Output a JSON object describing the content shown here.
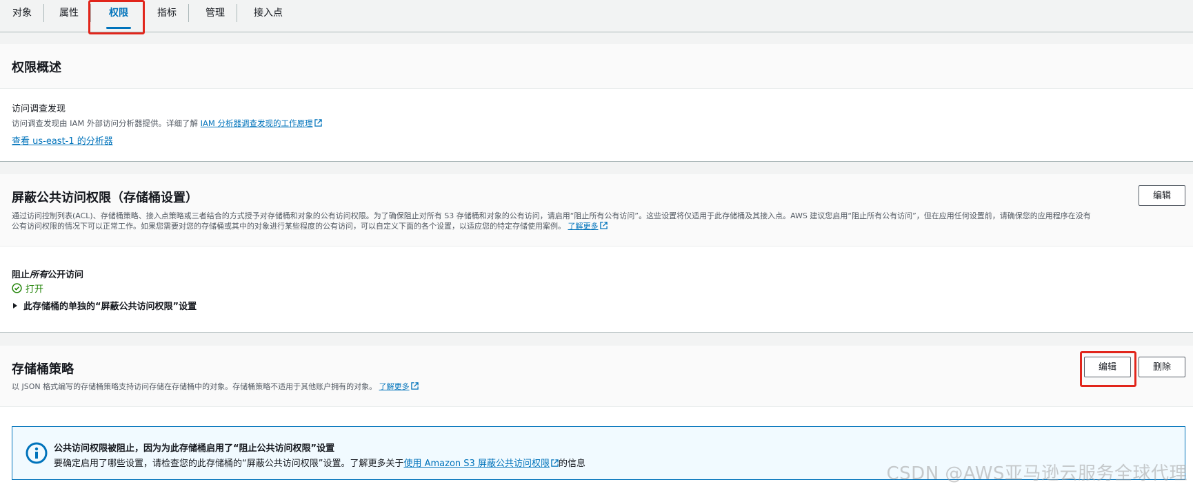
{
  "tabs": [
    {
      "label": "对象"
    },
    {
      "label": "属性"
    },
    {
      "label": "权限"
    },
    {
      "label": "指标"
    },
    {
      "label": "管理"
    },
    {
      "label": "接入点"
    }
  ],
  "overview": {
    "title": "权限概述",
    "findings_label": "访问调查发现",
    "findings_desc": "访问调查发现由 IAM 外部访问分析器提供。详细了解",
    "findings_link": "IAM 分析器调查发现的工作原理",
    "analyzer_link": "查看 us-east-1 的分析器"
  },
  "block_public": {
    "title": "屏蔽公共访问权限（存储桶设置）",
    "edit_label": "编辑",
    "desc_line1": "通过访问控制列表(ACL)、存储桶策略、接入点策略或三者结合的方式授予对存储桶和对象的公有访问权限。为了确保阻止对所有 S3 存储桶和对象的公有访问，请启用“阻止所有公有访问”。这些设置将仅适用于此存储桶及其接入点。AWS 建议您启用“阻止所有公有访问”，但在应用任何设置前，请确保您的应用程序在没有",
    "desc_line2": "公有访问权限的情况下可以正常工作。如果您需要对您的存储桶或其中的对象进行某些程度的公有访问，可以自定义下面的各个设置，以适应您的特定存储使用案例。",
    "learn_more": "了解更多",
    "block_all_prefix": "阻止",
    "block_all_em": "所有",
    "block_all_suffix": "公开访问",
    "status": "打开",
    "expand_label": "此存储桶的单独的“屏蔽公共访问权限”设置"
  },
  "policy": {
    "title": "存储桶策略",
    "desc": "以 JSON 格式编写的存储桶策略支持访问存储在存储桶中的对象。存储桶策略不适用于其他账户拥有的对象。",
    "learn_more": "了解更多",
    "edit_label": "编辑",
    "delete_label": "删除",
    "info_title": "公共访问权限被阻止，因为为此存储桶启用了“阻止公共访问权限”设置",
    "info_text_prefix": "要确定启用了哪些设置，请检查您的此存储桶的“屏蔽公共访问权限”设置。了解更多关于",
    "info_link": "使用 Amazon S3 屏蔽公共访问权限",
    "info_text_suffix": "的信息"
  },
  "watermark": "CSDN @AWS亚马逊云服务全球代理",
  "colors": {
    "accent": "#0073bb",
    "success": "#1d8102",
    "highlight": "#e1251b"
  }
}
